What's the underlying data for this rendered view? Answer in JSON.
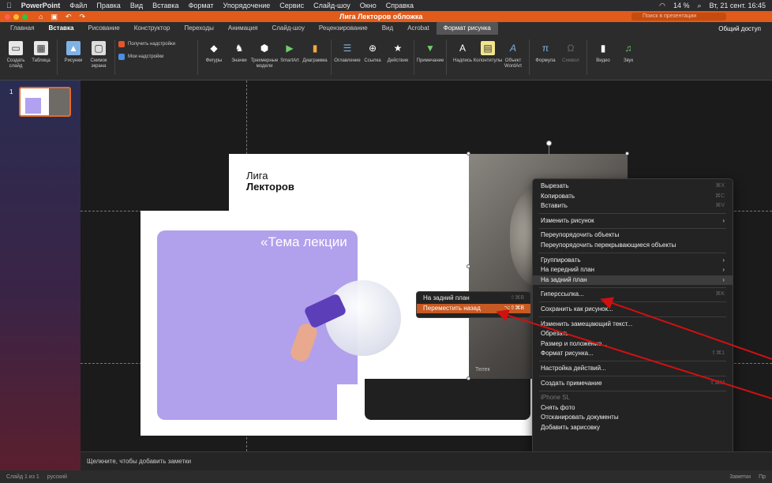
{
  "menubar": {
    "app": "PowerPoint",
    "items": [
      "Файл",
      "Правка",
      "Вид",
      "Вставка",
      "Формат",
      "Упорядочение",
      "Сервис",
      "Слайд-шоу",
      "Окно",
      "Справка"
    ],
    "battery": "14 %",
    "datetime": "Вт, 21 сент. 16:45"
  },
  "titlebar": {
    "doc_title": "Лига Лекторов обложка",
    "search_placeholder": "Поиск в презентации"
  },
  "tabs": {
    "items": [
      "Главная",
      "Вставка",
      "Рисование",
      "Конструктор",
      "Переходы",
      "Анимация",
      "Слайд-шоу",
      "Рецензирование",
      "Вид",
      "Acrobat",
      "Формат рисунка"
    ],
    "active": "Вставка",
    "share": "Общий доступ"
  },
  "ribbon": {
    "new_slide": "Создать слайд",
    "table": "Таблица",
    "pictures": "Рисунки",
    "screenshot": "Снимок экрана",
    "get_addins": "Получить надстройки",
    "my_addins": "Мои надстройки",
    "shapes": "Фигуры",
    "icons": "Значки",
    "models3d": "Трехмерные модели",
    "smartart": "SmartArt",
    "chart": "Диаграмма",
    "toc": "Оглавление",
    "link": "Ссылка",
    "action": "Действие",
    "comment": "Примечание",
    "textbox": "Надпись",
    "headerfooter": "Колонтитулы",
    "wordart": "Объект WordArt",
    "equation": "Формула",
    "symbol": "Символ",
    "video": "Видео",
    "audio": "Звук"
  },
  "thumbnail": {
    "number": "1"
  },
  "slide": {
    "title_line1": "Лига",
    "title_line2": "Лекторов",
    "theme": "«Тема лекции",
    "photo_caption": "Телек"
  },
  "context_menu": {
    "items": [
      {
        "label": "Вырезать",
        "shortcut": "⌘X"
      },
      {
        "label": "Копировать",
        "shortcut": "⌘C"
      },
      {
        "label": "Вставить",
        "shortcut": "⌘V"
      },
      {
        "sep": true
      },
      {
        "label": "Изменить рисунок",
        "arrow": "›"
      },
      {
        "sep": true
      },
      {
        "label": "Переупорядочить объекты"
      },
      {
        "label": "Переупорядочить перекрывающиеся объекты"
      },
      {
        "sep": true
      },
      {
        "label": "Группировать",
        "arrow": "›"
      },
      {
        "label": "На передний план",
        "arrow": "›"
      },
      {
        "label": "На задний план",
        "arrow": "›",
        "highlight": true
      },
      {
        "sep": true
      },
      {
        "label": "Гиперссылка...",
        "shortcut": "⌘K"
      },
      {
        "sep": true
      },
      {
        "label": "Сохранить как рисунок..."
      },
      {
        "sep": true
      },
      {
        "label": "Изменить замещающий текст..."
      },
      {
        "label": "Обрезать"
      },
      {
        "label": "Размер и положение..."
      },
      {
        "label": "Формат рисунка...",
        "shortcut": "⇧⌘1"
      },
      {
        "sep": true
      },
      {
        "label": "Настройка действий..."
      },
      {
        "sep": true
      },
      {
        "label": "Создать примечание",
        "shortcut": "⇧⌘M"
      },
      {
        "sep": true
      },
      {
        "label": "iPhone SL",
        "disabled": true
      },
      {
        "label": "Снять фото"
      },
      {
        "label": "Отсканировать документы"
      },
      {
        "label": "Добавить зарисовку"
      }
    ]
  },
  "submenu": {
    "items": [
      {
        "label": "На задний план",
        "shortcut": "⇧⌘B"
      },
      {
        "label": "Переместить назад",
        "shortcut": "⌥⇧⌘B",
        "selected": true
      }
    ]
  },
  "notes": {
    "placeholder": "Щелкните, чтобы добавить заметки"
  },
  "status": {
    "slide": "Слайд 1 из 1",
    "lang": "русский",
    "notes": "Заметки",
    "comments": "Пр"
  },
  "colors": {
    "accent": "#e25b1a",
    "purple": "#b1a0ec",
    "annotation": "#d11010"
  }
}
